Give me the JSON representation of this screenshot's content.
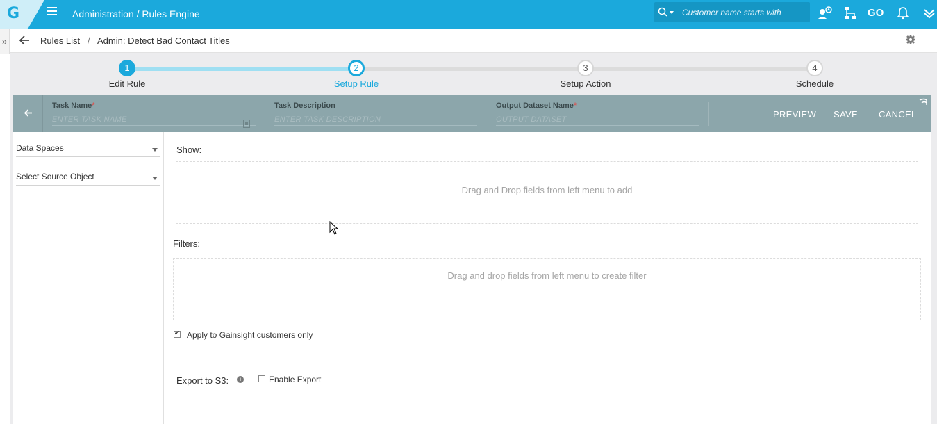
{
  "topbar": {
    "logo": "G",
    "title": "Administration / Rules Engine",
    "search_placeholder": "Customer name starts with",
    "icons": [
      "user-search-icon",
      "hierarchy-icon",
      "go-icon",
      "bell-icon",
      "chevrons-down-icon"
    ],
    "go_label": "GO",
    "brand_color": "#1ba9dc"
  },
  "breadcrumb": {
    "toggle": "»",
    "items": [
      "Rules List",
      "/",
      "Admin: Detect Bad Contact Titles"
    ]
  },
  "stepper": {
    "steps": [
      {
        "number": "1",
        "label": "Edit Rule",
        "state": "done"
      },
      {
        "number": "2",
        "label": "Setup Rule",
        "state": "active"
      },
      {
        "number": "3",
        "label": "Setup Action",
        "state": "pending"
      },
      {
        "number": "4",
        "label": "Schedule",
        "state": "pending"
      }
    ]
  },
  "task": {
    "name_label": "Task Name",
    "name_placeholder": "ENTER TASK NAME",
    "description_label": "Task Description",
    "description_placeholder": "ENTER TASK DESCRIPTION",
    "output_label": "Output Dataset Name",
    "output_placeholder": "OUTPUT DATASET",
    "required_mark": "*",
    "preview": "PREVIEW",
    "save": "SAVE",
    "cancel": "CANCEL",
    "bar_color": "#8ca6ab"
  },
  "left": {
    "data_spaces": "Data Spaces",
    "source_object": "Select Source Object"
  },
  "main": {
    "show_label": "Show:",
    "show_hint": "Drag and Drop fields from left menu to add",
    "filters_label": "Filters:",
    "filters_hint": "Drag and drop fields from left menu to create filter",
    "apply_label": "Apply to Gainsight customers only",
    "apply_checked": true,
    "export_label": "Export to S3:",
    "enable_export_label": "Enable Export",
    "enable_export_checked": false
  }
}
